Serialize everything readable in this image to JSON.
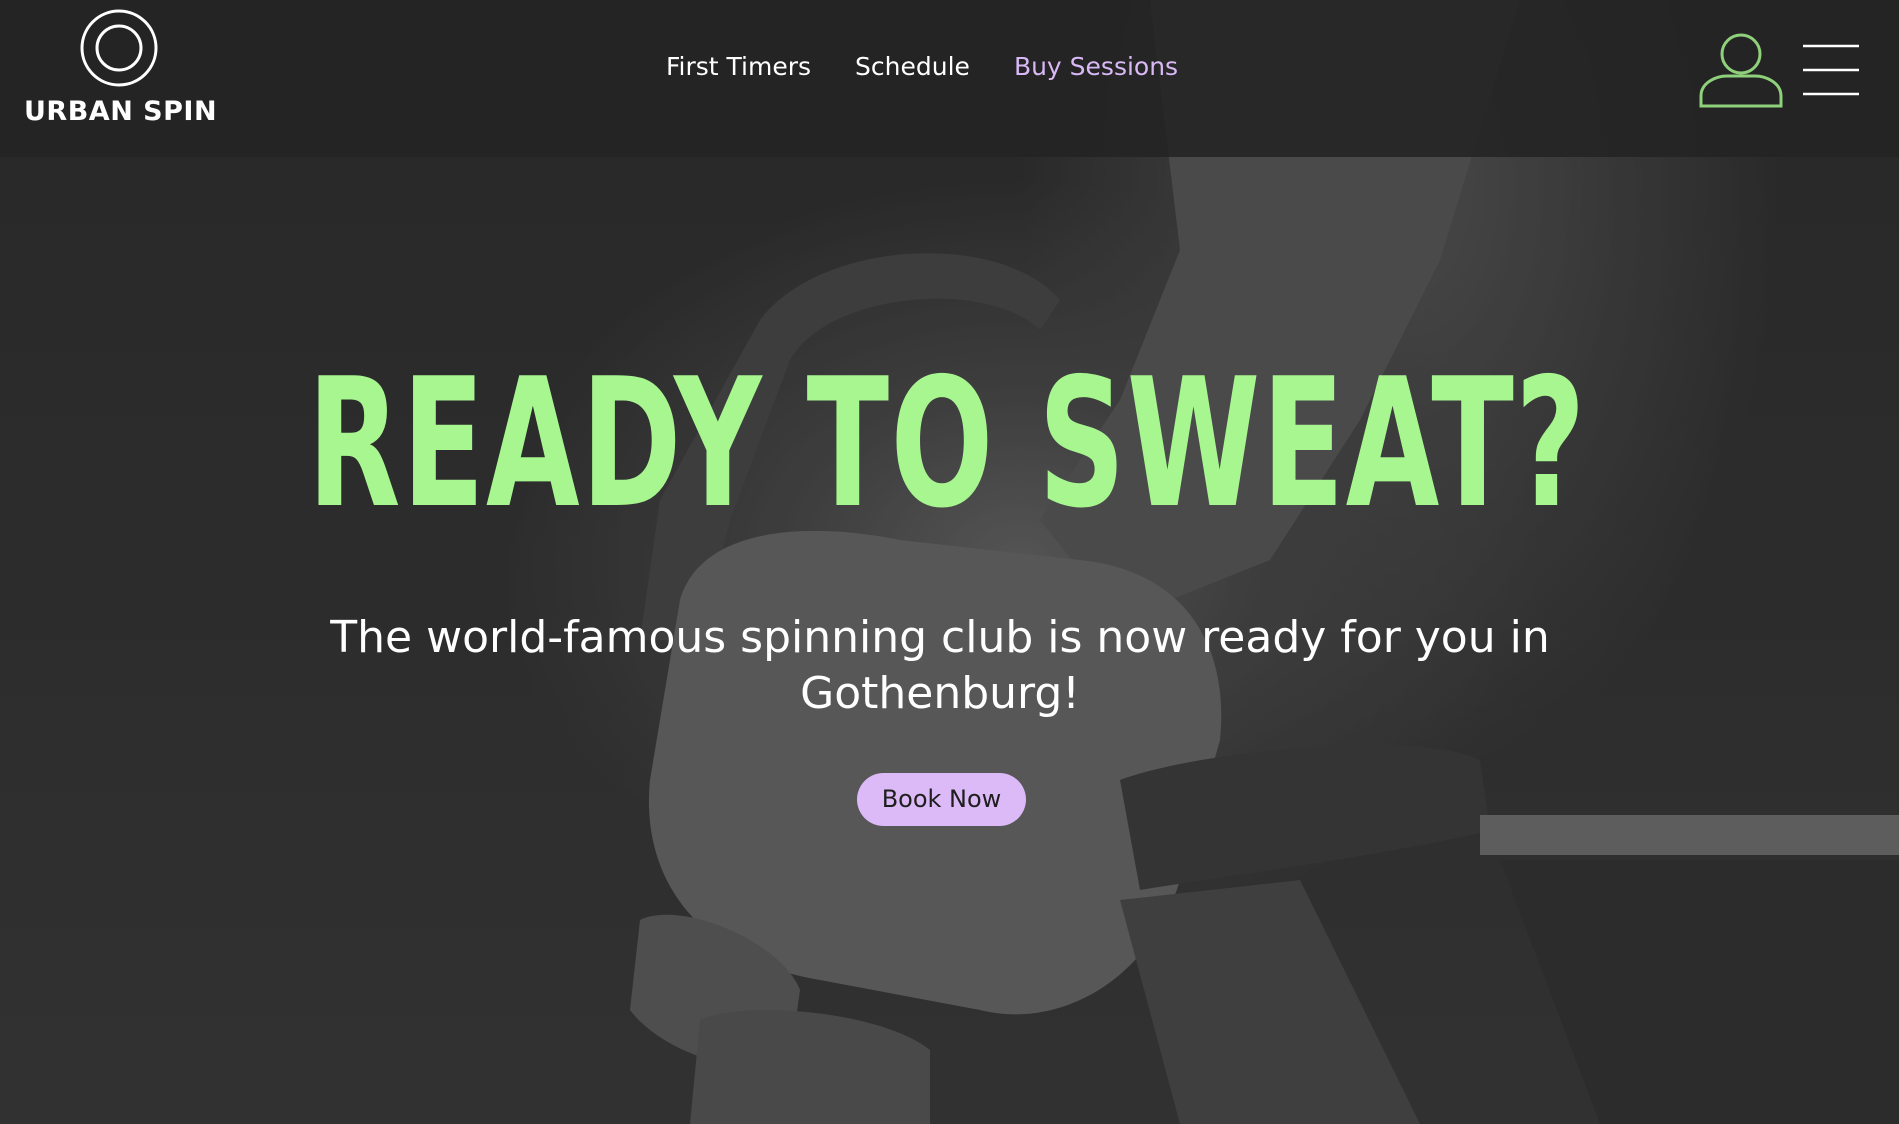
{
  "header": {
    "logo_text": "URBAN SPIN",
    "nav": {
      "first_timers": "First Timers",
      "schedule": "Schedule",
      "buy_sessions": "Buy Sessions"
    },
    "icons": {
      "logo": "double-circle-logo",
      "user": "user-icon",
      "menu": "hamburger-menu-icon"
    }
  },
  "hero": {
    "title": "READY TO SWEAT?",
    "subtitle": "The world-famous spinning club is now ready for you in Gothenburg!",
    "cta_label": "Book Now"
  },
  "colors": {
    "accent_green": "#a7f68f",
    "accent_purple": "#dcb9f7",
    "header_bg": "#232323"
  }
}
